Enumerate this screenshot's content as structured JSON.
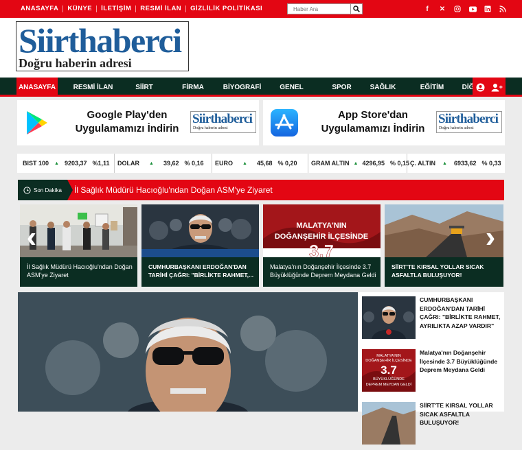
{
  "topbar": {
    "links": [
      "ANASAYFA",
      "KÜNYE",
      "İLETİŞİM",
      "RESMİ İLAN",
      "GİZLİLİK POLİTİKASI"
    ],
    "search_placeholder": "Haber Ara",
    "social": [
      "facebook-icon",
      "x-icon",
      "instagram-icon",
      "youtube-icon",
      "linkedin-icon",
      "rss-icon"
    ]
  },
  "logo": {
    "name_part1": "Siirt",
    "name_part2": "haberci",
    "slogan": "Doğru haberin adresi"
  },
  "mainnav": {
    "items": [
      "ANASAYFA",
      "RESMİ İLAN",
      "SİİRT",
      "FİRMA",
      "BİYOGRAFİ",
      "GENEL",
      "SPOR",
      "SAĞLIK",
      "EĞİTİM",
      "DİĞER"
    ],
    "active_index": 0
  },
  "banners": {
    "google": {
      "line1": "Google Play'den",
      "line2": "Uygulamamızı İndirin"
    },
    "apple": {
      "line1": "App Store'dan",
      "line2": "Uygulamamızı İndirin"
    },
    "mini_logo_name": "Siirthaberci",
    "mini_logo_slogan": "Doğru haberin adresi"
  },
  "markets": [
    {
      "name": "BIST 100",
      "price": "9203,37",
      "change": "%1,11"
    },
    {
      "name": "DOLAR",
      "price": "39,62",
      "change": "% 0,16"
    },
    {
      "name": "EURO",
      "price": "45,68",
      "change": "% 0,20"
    },
    {
      "name": "GRAM ALTIN",
      "price": "4296,95",
      "change": "% 0,15"
    },
    {
      "name": "Ç. ALTIN",
      "price": "6933,62",
      "change": "% 0,33"
    }
  ],
  "breaking": {
    "label": "Son Dakika",
    "headline": "İl Sağlık Müdürü Hacıoğlu'ndan Doğan ASM'ye Ziyaret"
  },
  "slider": [
    {
      "title": "İl Sağlık Müdürü Hacıoğlu'ndan Doğan ASM'ye Ziyaret"
    },
    {
      "title": "CUMHURBAŞKANI ERDOĞAN'DAN TARİHİ ÇAĞRI: \"BİRLİKTE RAHMET,..."
    },
    {
      "title": "Malatya'nın Doğanşehir İlçesinde 3.7 Büyüklüğünde Deprem Meydana Geldi",
      "overlay_line1": "MALATYA'NIN",
      "overlay_line2": "DOĞANŞEHİR İLÇESİNDE",
      "overlay_mag": "3.7"
    },
    {
      "title": "SİİRT'TE KIRSAL YOLLAR SICAK ASFALTLA BULUŞUYOR!"
    }
  ],
  "sidelist": [
    {
      "title": "CUMHURBAŞKANI ERDOĞAN'DAN TARİHİ ÇAĞRI: \"BİRLİKTE RAHMET, AYRILIKTA AZAP VARDIR\""
    },
    {
      "title": "Malatya'nın Doğanşehir İlçesinde 3.7 Büyüklüğünde Deprem Meydana Geldi",
      "thumb_l1": "MALATYA'NIN",
      "thumb_l2": "DOĞANŞEHİR İLÇESİNDE",
      "thumb_mag": "3.7",
      "thumb_l3": "BÜYÜKLÜĞÜNDE",
      "thumb_l4": "DEPREM MEYDAN GELDİ"
    },
    {
      "title": "SİİRT'TE KIRSAL YOLLAR SICAK ASFALTLA BULUŞUYOR!"
    }
  ],
  "colors": {
    "brand_red": "#e30613",
    "nav_dark": "#0b2d22",
    "logo_blue": "#1f5d9a",
    "logo_green": "#2e7d32"
  }
}
